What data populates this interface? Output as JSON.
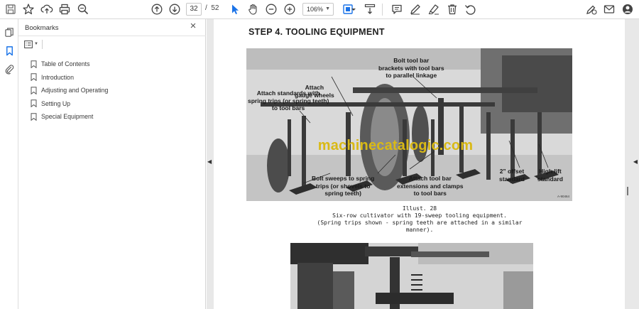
{
  "toolbar": {
    "current_page": "32",
    "page_separator": "/",
    "total_pages": "52",
    "zoom": "106%"
  },
  "bookmarks_panel": {
    "title": "Bookmarks",
    "items": [
      {
        "label": "Table of Contents"
      },
      {
        "label": "Introduction"
      },
      {
        "label": "Adjusting and Operating"
      },
      {
        "label": "Setting Up"
      },
      {
        "label": "Special Equipment"
      }
    ]
  },
  "document": {
    "step_title": "STEP 4.  TOOLING EQUIPMENT",
    "callouts": {
      "gauge_wheels": "Attach\ngauge wheels",
      "bolt_tool_bar": "Bolt tool bar\nbrackets with tool bars\nto parallel linkage",
      "attach_standards": "Attach standards with\nspring trips (or spring teeth)\nto tool bars",
      "bolt_sweeps": "Bolt sweeps to spring\ntrips (or shovels to\nspring teeth)",
      "tool_bar_ext": "Attach tool bar\nextensions and clamps\nto tool bars",
      "offset_standard": "2” offset\nstandard",
      "high_lift": "High lift\nstandard"
    },
    "illust_code": "A-90464",
    "watermark": "machinecatalogic.com",
    "caption_title": "Illust. 28",
    "caption_line1": "Six-row cultivator with 19-sweep tooling equipment.",
    "caption_line2": "(Spring trips shown - spring teeth are attached in a similar manner)."
  },
  "colors": {
    "accent": "#1a73e8",
    "watermark": "#d9b915",
    "viewer_bg": "#e8e8e8"
  },
  "icons": [
    "save-icon",
    "star-icon",
    "upload-icon",
    "print-icon",
    "zoom-search-icon",
    "page-up-icon",
    "page-down-icon",
    "select-cursor-icon",
    "hand-icon",
    "zoom-out-icon",
    "zoom-in-icon",
    "page-fit-icon",
    "scroll-mode-icon",
    "comment-icon",
    "pen-icon",
    "highlighter-icon",
    "erase-icon",
    "delete-icon",
    "undo-icon",
    "sign-icon",
    "mail-icon",
    "account-icon",
    "pages-icon",
    "bookmark-icon",
    "attachment-icon"
  ]
}
